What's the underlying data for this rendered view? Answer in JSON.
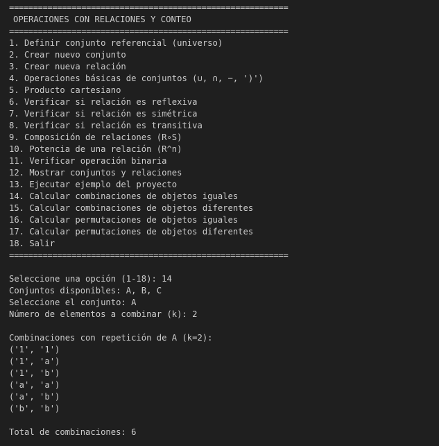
{
  "separator": "==========================================================",
  "title": "OPERACIONES CON RELACIONES Y CONTEO",
  "menu_items": [
    "1. Definir conjunto referencial (universo)",
    "2. Crear nuevo conjunto",
    "3. Crear nueva relación",
    "4. Operaciones básicas de conjuntos (∪, ∩, −, ')')",
    "5. Producto cartesiano",
    "6. Verificar si relación es reflexiva",
    "7. Verificar si relación es simétrica",
    "8. Verificar si relación es transitiva",
    "9. Composición de relaciones (R∘S)",
    "10. Potencia de una relación (R^n)",
    "11. Verificar operación binaria",
    "12. Mostrar conjuntos y relaciones",
    "13. Ejecutar ejemplo del proyecto",
    "14. Calcular combinaciones de objetos iguales",
    "15. Calcular combinaciones de objetos diferentes",
    "16. Calcular permutaciones de objetos iguales",
    "17. Calcular permutaciones de objetos diferentes",
    "18. Salir"
  ],
  "prompts": [
    "Seleccione una opción (1-18): 14",
    "Conjuntos disponibles: A, B, C",
    "Seleccione el conjunto: A",
    "Número de elementos a combinar (k): 2"
  ],
  "result_header": "Combinaciones con repetición de A (k=2):",
  "combinations": [
    "('1', '1')",
    "('1', 'a')",
    "('1', 'b')",
    "('a', 'a')",
    "('a', 'b')",
    "('b', 'b')"
  ],
  "total_line": "Total de combinaciones: 6",
  "colors": {
    "background": "#1f1f1f",
    "text": "#cccccc"
  }
}
